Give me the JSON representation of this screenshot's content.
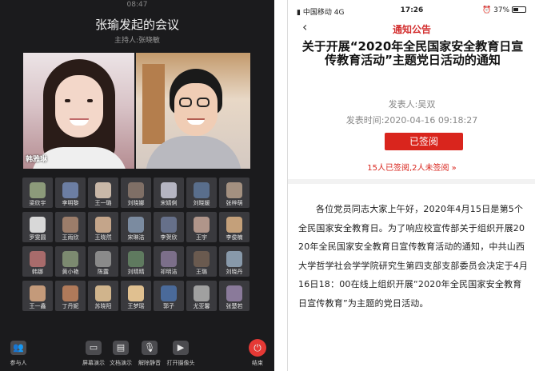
{
  "meeting": {
    "status_time": "08:47",
    "title": "张瑜发起的会议",
    "host": "主持人:张晓敏",
    "videos": [
      {
        "name": "韩雅琳"
      },
      {
        "name": ""
      }
    ],
    "participants": [
      {
        "name": "梁欣宇",
        "color": "#8c9a7a"
      },
      {
        "name": "李明黎",
        "color": "#6c7ea3"
      },
      {
        "name": "王一璐",
        "color": "#c9b8a8"
      },
      {
        "name": "刘晓娜",
        "color": "#7f6f66"
      },
      {
        "name": "宋婧俐",
        "color": "#b5b5c2"
      },
      {
        "name": "刘晓媛",
        "color": "#596e8c"
      },
      {
        "name": "张梓萌",
        "color": "#a39080"
      },
      {
        "name": "罗雯圆",
        "color": "#d8d8d8"
      },
      {
        "name": "王雨欣",
        "color": "#9c7d6a"
      },
      {
        "name": "王晓然",
        "color": "#c4a58a"
      },
      {
        "name": "宋琳洁",
        "color": "#7b8ba0"
      },
      {
        "name": "李贺欣",
        "color": "#66708a"
      },
      {
        "name": "王宇",
        "color": "#b0958a"
      },
      {
        "name": "李俊楠",
        "color": "#c4a07a"
      },
      {
        "name": "韩娜",
        "color": "#a86b6b"
      },
      {
        "name": "黄小艳",
        "color": "#7c8a70"
      },
      {
        "name": "陈露",
        "color": "#8a8a8a"
      },
      {
        "name": "刘晴晴",
        "color": "#5f7a5f"
      },
      {
        "name": "祁明洁",
        "color": "#7c6f8a"
      },
      {
        "name": "王璐",
        "color": "#6a5a4f"
      },
      {
        "name": "刘晓丹",
        "color": "#8899aa"
      },
      {
        "name": "王一鑫",
        "color": "#c49a7a"
      },
      {
        "name": "丁丹妮",
        "color": "#b07a5a"
      },
      {
        "name": "苏晓阳",
        "color": "#d0b48c"
      },
      {
        "name": "王梦瑶",
        "color": "#e0c090"
      },
      {
        "name": "郭子",
        "color": "#4a6a9a"
      },
      {
        "name": "尤亚馨",
        "color": "#a0a0a0"
      },
      {
        "name": "张楚若",
        "color": "#8a7a9a"
      }
    ],
    "toolbar": [
      {
        "label": "参与人",
        "icon": "users-icon"
      },
      {
        "label": "屏幕演示",
        "icon": "screen-share-icon"
      },
      {
        "label": "文档演示",
        "icon": "document-icon"
      },
      {
        "label": "解除静音",
        "icon": "mic-muted-icon"
      },
      {
        "label": "打开摄像头",
        "icon": "camera-off-icon"
      },
      {
        "label": "结束",
        "icon": "power-icon"
      }
    ]
  },
  "notice": {
    "status": {
      "carrier": "中国移动",
      "network": "4G",
      "time": "17:26",
      "battery": "37%"
    },
    "nav_title": "通知公告",
    "back_glyph": "‹",
    "title": "关于开展“2020年全民国家安全教育日宣传教育活动”主题党日活动的通知",
    "publisher": "发表人:吴双",
    "publish_time": "发表时间:2020-04-16 09:18:27",
    "sign_button": "已签阅",
    "sign_status": "15人已签阅,2人未签阅 »",
    "body": "各位党员同志大家上午好，2020年4月15日是第5个全民国家安全教育日。为了响应校宣传部关于组织开展2020年全民国家安全教育日宣传教育活动的通知，中共山西大学哲学社会学学院研究生第四支部支部委员会决定于4月16日18：00在线上组织开展“2020年全民国家安全教育日宣传教育”为主题的党日活动。"
  }
}
